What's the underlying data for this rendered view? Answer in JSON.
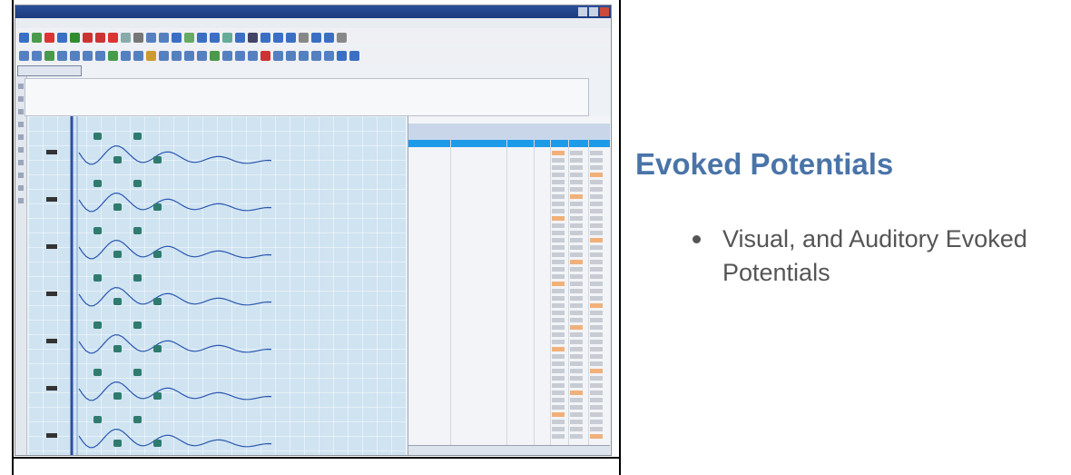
{
  "slide": {
    "heading": "Evoked Potentials",
    "bullets": [
      "Visual, and Auditory Evoked Potentials"
    ]
  },
  "screenshot": {
    "icons": [
      "window-icon",
      "toolbar-icons",
      "waveform-plot",
      "results-table"
    ]
  }
}
